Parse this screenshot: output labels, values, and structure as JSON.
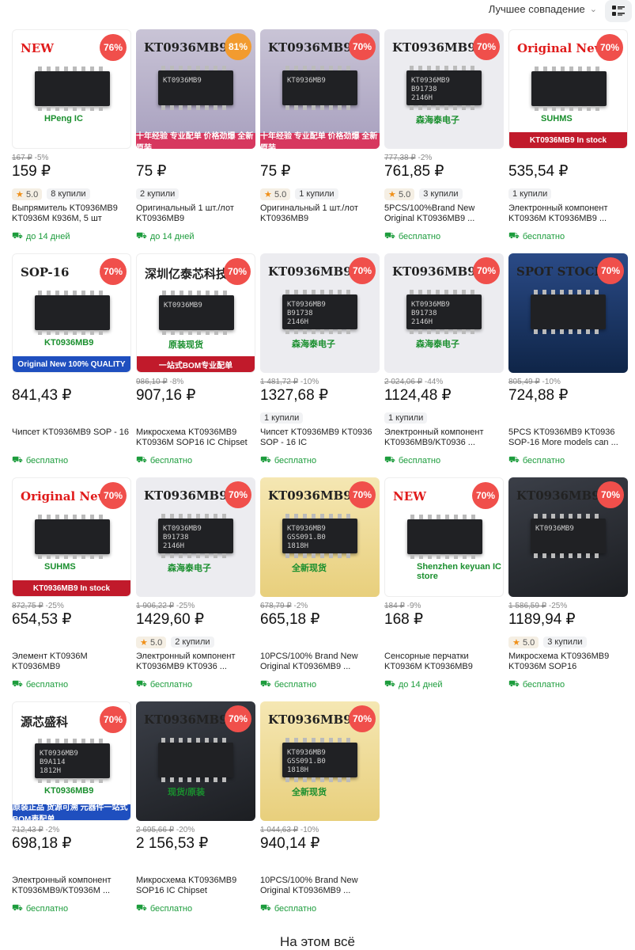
{
  "header": {
    "sort_label": "Лучшее совпадение",
    "sort_icon": "chevron-down-icon",
    "view_icon": "list-view-icon"
  },
  "products": [
    {
      "img_text": "NEW",
      "img_sub": "HPeng IC",
      "chip_mark": "",
      "style": "white",
      "discount": "76%",
      "badge": "red",
      "old_price": "167 ₽",
      "old_disc": "-5%",
      "price": "159 ₽",
      "rating": "5.0",
      "sold": "8 купили",
      "title": "Выпрямитель KT0936MB9 KT0936M К936М, 5 шт",
      "ship": "до 14 дней"
    },
    {
      "img_text": "KT0936MB9",
      "img_sub": "",
      "chip_mark": "KT0936MB9",
      "style": "purple",
      "discount": "81%",
      "badge": "orange",
      "banner": "十年经验 专业配单  价格劲爆 全新原装",
      "banner_style": "pink",
      "old_price": "",
      "old_disc": "",
      "price": "75 ₽",
      "rating": "",
      "sold": "2 купили",
      "title": "Оригинальный 1 шт./лот KT0936MB9",
      "ship": "до 14 дней"
    },
    {
      "img_text": "KT0936MB9",
      "img_sub": "",
      "chip_mark": "KT0936MB9",
      "style": "purple",
      "discount": "70%",
      "badge": "red",
      "banner": "十年经验 专业配单  价格劲爆 全新原装",
      "banner_style": "pink",
      "old_price": "",
      "old_disc": "",
      "price": "75 ₽",
      "rating": "5.0",
      "sold": "1 купили",
      "title": "Оригинальный 1 шт./лот KT0936MB9",
      "ship": ""
    },
    {
      "img_text": "KT0936MB9",
      "img_sub": "森海泰电子",
      "chip_mark": "KT0936MB9\nB91738\n2146H",
      "style": "light",
      "discount": "70%",
      "badge": "red",
      "old_price": "777,38 ₽",
      "old_disc": "-2%",
      "price": "761,85 ₽",
      "rating": "5.0",
      "sold": "3 купили",
      "title": "5PCS/100%Brand New Original KT0936MB9 ...",
      "ship": "бесплатно"
    },
    {
      "img_text": "Original New",
      "img_sub": "SUHMS",
      "chip_mark": "",
      "style": "white",
      "discount": "70%",
      "badge": "red",
      "banner": "KT0936MB9  In stock",
      "banner_style": "red",
      "old_price": "",
      "old_disc": "",
      "price": "535,54 ₽",
      "rating": "",
      "sold": "1 купили",
      "title": "Электронный компонент KT0936M KT0936MB9 ...",
      "ship": "бесплатно"
    },
    {
      "img_text": "SOP-16",
      "img_sub": "KT0936MB9",
      "chip_mark": "",
      "style": "white",
      "discount": "70%",
      "badge": "red",
      "banner": "Original New  100% QUALITY",
      "banner_style": "blue",
      "old_price": "",
      "old_disc": "",
      "price": "841,43 ₽",
      "rating": "",
      "sold": "",
      "title": "Чипсет KT0936MB9 SOP - 16",
      "ship": "бесплатно"
    },
    {
      "img_text": "深圳亿泰芯科技",
      "img_sub": "原装现货",
      "chip_mark": "KT0936MB9",
      "style": "white",
      "discount": "70%",
      "badge": "red",
      "banner": "一站式BOM专业配单",
      "banner_style": "red",
      "old_price": "986,10 ₽",
      "old_disc": "-8%",
      "price": "907,16 ₽",
      "rating": "",
      "sold": "",
      "title": "Микросхема KT0936MB9 KT0936M SOP16 IC Chipset",
      "ship": "бесплатно"
    },
    {
      "img_text": "KT0936MB9",
      "img_sub": "森海泰电子",
      "chip_mark": "KT0936MB9\nB91738\n2146H",
      "style": "light",
      "discount": "70%",
      "badge": "red",
      "old_price": "1 481,72 ₽",
      "old_disc": "-10%",
      "price": "1327,68 ₽",
      "rating": "",
      "sold": "1 купили",
      "title": "Чипсет KT0936MB9 KT0936 SOP - 16 IC",
      "ship": "бесплатно"
    },
    {
      "img_text": "KT0936MB9",
      "img_sub": "森海泰电子",
      "chip_mark": "KT0936MB9\nB91738\n2146H",
      "style": "light",
      "discount": "70%",
      "badge": "red",
      "old_price": "2 024,06 ₽",
      "old_disc": "-44%",
      "price": "1124,48 ₽",
      "rating": "",
      "sold": "1 купили",
      "title": "Электронный компонент KT0936MB9/KT0936 ...",
      "ship": "бесплатно"
    },
    {
      "img_text": "SPOT STOCK",
      "img_sub": "",
      "chip_mark": "",
      "style": "blue",
      "discount": "70%",
      "badge": "red",
      "old_price": "805,49 ₽",
      "old_disc": "-10%",
      "price": "724,88 ₽",
      "rating": "",
      "sold": "",
      "title": "5PCS KT0936MB9 KT0936 SOP-16 More models can ...",
      "ship": "бесплатно"
    },
    {
      "img_text": "Original New",
      "img_sub": "SUHMS",
      "chip_mark": "",
      "style": "white",
      "discount": "70%",
      "badge": "red",
      "banner": "KT0936MB9  In stock",
      "banner_style": "red",
      "old_price": "872,75 ₽",
      "old_disc": "-25%",
      "price": "654,53 ₽",
      "rating": "",
      "sold": "",
      "title": "Элемент KT0936M KT0936MB9",
      "ship": "бесплатно"
    },
    {
      "img_text": "KT0936MB9",
      "img_sub": "森海泰电子",
      "chip_mark": "KT0936MB9\nB91738\n2146H",
      "style": "light",
      "discount": "70%",
      "badge": "red",
      "old_price": "1 906,22 ₽",
      "old_disc": "-25%",
      "price": "1429,60 ₽",
      "rating": "5.0",
      "sold": "2 купили",
      "title": "Электронный компонент KT0936MB9 KT0936 ...",
      "ship": "бесплатно"
    },
    {
      "img_text": "KT0936MB9",
      "img_sub": "全新现货",
      "chip_mark": "KT0936MB9\nGSS091.B0\n1818H",
      "style": "gold",
      "discount": "70%",
      "badge": "red",
      "old_price": "678,79 ₽",
      "old_disc": "-2%",
      "price": "665,18 ₽",
      "rating": "",
      "sold": "",
      "title": "10PCS/100% Brand New Original KT0936MB9 ...",
      "ship": "бесплатно"
    },
    {
      "img_text": "NEW",
      "img_sub": "Shenzhen keyuan IC store",
      "chip_mark": "",
      "style": "white",
      "discount": "70%",
      "badge": "red",
      "old_price": "184 ₽",
      "old_disc": "-9%",
      "price": "168 ₽",
      "rating": "",
      "sold": "",
      "title": "Сенсорные перчатки KT0936M KT0936MB9",
      "ship": "до 14 дней"
    },
    {
      "img_text": "KT0936MB9",
      "img_sub": "",
      "chip_mark": "KT0936MB9",
      "style": "dark",
      "discount": "70%",
      "badge": "red",
      "old_price": "1 586,59 ₽",
      "old_disc": "-25%",
      "price": "1189,94 ₽",
      "rating": "5.0",
      "sold": "3 купили",
      "title": "Микросхема KT0936MB9 KT0936M SOP16",
      "ship": "бесплатно"
    },
    {
      "img_text": "源芯盛科",
      "img_sub": "KT0936MB9",
      "chip_mark": "KT0936MB9\nB9A114\n1812H",
      "style": "white",
      "discount": "70%",
      "badge": "red",
      "banner": "原装正品 货源可溯 元器件一站式BOM表配单",
      "banner_style": "blue",
      "old_price": "712,43 ₽",
      "old_disc": "-2%",
      "price": "698,18 ₽",
      "rating": "",
      "sold": "",
      "title": "Электронный компонент KT0936MB9/KT0936M ...",
      "ship": "бесплатно"
    },
    {
      "img_text": "KT0936MB9",
      "img_sub": "现货/原装",
      "chip_mark": "",
      "style": "dark",
      "discount": "70%",
      "badge": "red",
      "old_price": "2 695,66 ₽",
      "old_disc": "-20%",
      "price": "2 156,53 ₽",
      "rating": "",
      "sold": "",
      "title": "Микросхема KT0936MB9 SOP16 IC Chipset",
      "ship": "бесплатно"
    },
    {
      "img_text": "KT0936MB9",
      "img_sub": "全新现货",
      "chip_mark": "KT0936MB9\nGSS091.B0\n1818H",
      "style": "gold",
      "discount": "70%",
      "badge": "red",
      "old_price": "1 044,63 ₽",
      "old_disc": "-10%",
      "price": "940,14 ₽",
      "rating": "",
      "sold": "",
      "title": "10PCS/100% Brand New Original KT0936MB9 ...",
      "ship": "бесплатно"
    }
  ],
  "footer": {
    "end_text": "На этом всё"
  }
}
